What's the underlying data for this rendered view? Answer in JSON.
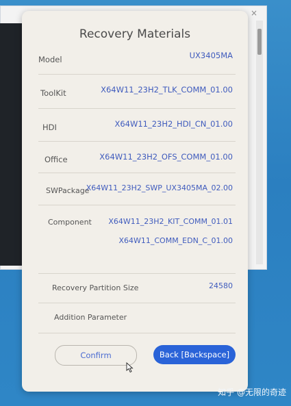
{
  "dialog": {
    "title": "Recovery Materials",
    "rows": [
      {
        "label": "Model",
        "value": "UX3405MA"
      },
      {
        "label": "ToolKit",
        "value": "X64W11_23H2_TLK_COMM_01.00"
      },
      {
        "label": "HDI",
        "value": "X64W11_23H2_HDI_CN_01.00"
      },
      {
        "label": "Office",
        "value": "X64W11_23H2_OFS_COMM_01.00"
      },
      {
        "label": "SWPackage",
        "value": "X64W11_23H2_SWP_UX3405MA_02.00"
      },
      {
        "label": "Component",
        "value": "X64W11_23H2_KIT_COMM_01.01",
        "value2": "X64W11_COMM_EDN_C_01.00"
      },
      {
        "label": "Recovery Partition Size",
        "value": "24580"
      },
      {
        "label": "Addition Parameter",
        "value": ""
      }
    ],
    "buttons": {
      "confirm": "Confirm",
      "back": "Back [Backspace]"
    }
  },
  "background_window": {
    "close": "×"
  },
  "watermark": "知乎 @无限的奇迹",
  "colors": {
    "accent": "#2a63d8",
    "value_text": "#3f5bbd",
    "dialog_bg": "#f2efe9",
    "desktop_bg": "#2f86c4"
  },
  "icons": {
    "cursor": "mouse-pointer-icon",
    "close": "close-icon"
  }
}
